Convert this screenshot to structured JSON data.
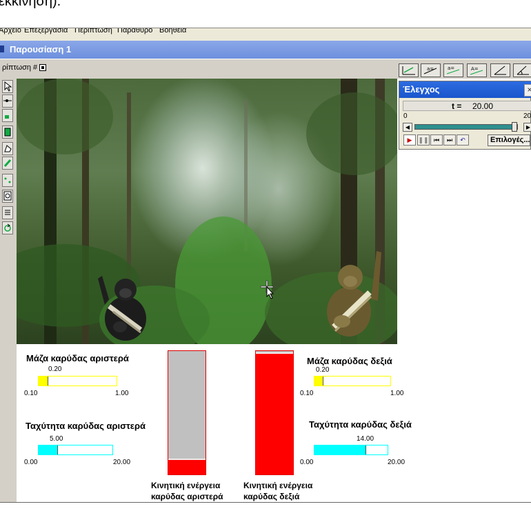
{
  "page_top_cut_text": "εκκίνηση).",
  "menu": {
    "items": [
      "Αρχείο",
      "Επεξεργασία",
      "Περίπτωση",
      "Παράθυρο",
      "Βοήθεια"
    ]
  },
  "window": {
    "title": "Παρουσίαση 1"
  },
  "toolbar": {
    "case_label": "ρίπτωση #",
    "tool_icons": [
      "axes-icon",
      "slider-tool-icon",
      "dual-slider-icon",
      "text-tool-icon",
      "angle-tool-icon",
      "angle-tool-2-icon"
    ]
  },
  "left_tools": [
    "arrow-icon",
    "point-icon",
    "body-icon",
    "rect-icon",
    "polygon-icon",
    "pen-icon",
    "constraint-icon",
    "meter-icon",
    "list-icon",
    "rotate-icon"
  ],
  "control": {
    "title": "Έλεγχος",
    "close": "×",
    "time_label": "t =",
    "time_value": "20.00",
    "range_min": "0",
    "range_max": "20",
    "time_fraction": 1.0,
    "options_label": "Επιλογές...",
    "buttons": [
      "play-icon",
      "pause-icon",
      "step-back-icon",
      "step-forward-icon",
      "reset-icon"
    ]
  },
  "left_mass": {
    "label": "Μάζα καρύδας αριστερά",
    "value": "0.20",
    "min": "0.10",
    "max": "1.00",
    "fraction": 0.111
  },
  "left_speed": {
    "label": "Ταχύτητα καρύδας αριστερά",
    "value": "5.00",
    "min": "0.00",
    "max": "20.00",
    "fraction": 0.25
  },
  "right_mass": {
    "label": "Μάζα καρύδας δεξιά",
    "value": "0.20",
    "min": "0.10",
    "max": "1.00",
    "fraction": 0.111
  },
  "right_speed": {
    "label": "Ταχύτητα καρύδας δεξιά",
    "value": "14.00",
    "min": "0.00",
    "max": "20.00",
    "fraction": 0.7
  },
  "left_energy": {
    "label_line1": "Κινητική ενέργεια",
    "label_line2": "καρύδας αριστερά",
    "fill_fraction": 0.12
  },
  "right_energy": {
    "label_line1": "Κινητική ενέργεια",
    "label_line2": "καρύδας δεξιά",
    "fill_fraction": 0.98
  },
  "colors": {
    "mass_fill": "#ffff00",
    "speed_fill": "#00ffff",
    "energy_fill": "#ff0000",
    "energy_empty": "#c0c0c0",
    "title_blue": "#7b9ae3"
  }
}
